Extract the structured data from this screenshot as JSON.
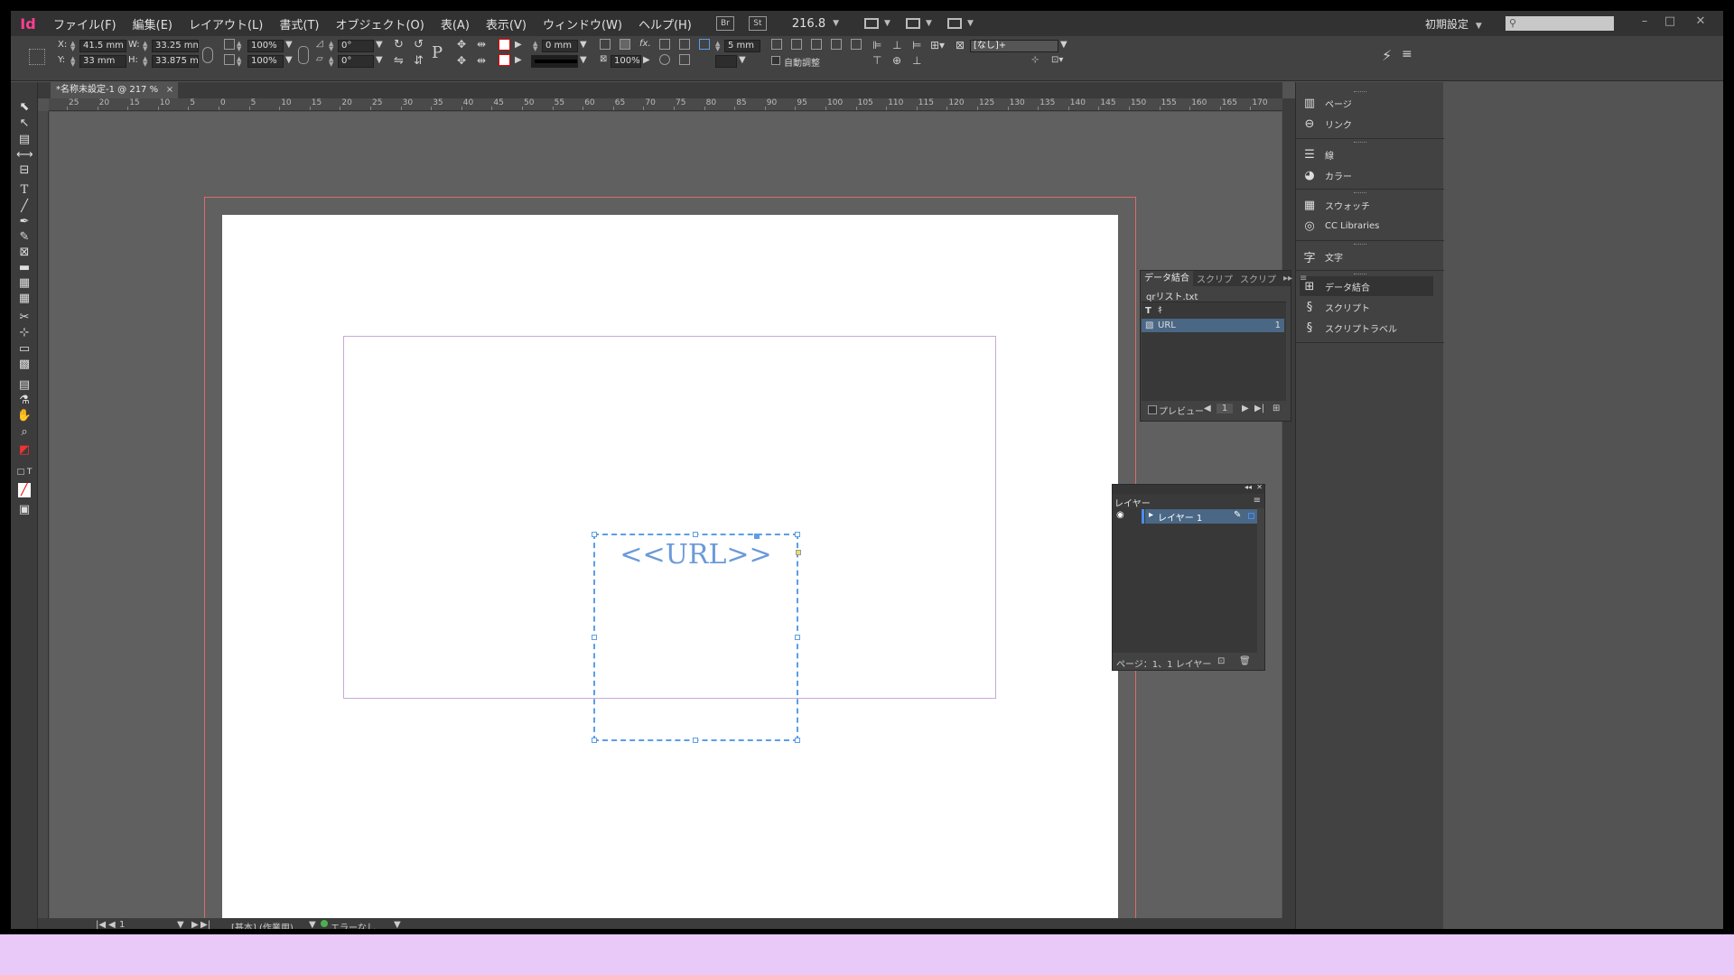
{
  "app": {
    "logo": "Id"
  },
  "menubar": {
    "items": [
      "ファイル(F)",
      "編集(E)",
      "レイアウト(L)",
      "書式(T)",
      "オブジェクト(O)",
      "表(A)",
      "表示(V)",
      "ウィンドウ(W)",
      "ヘルプ(H)"
    ],
    "bridge_label": "Br",
    "stock_label": "St",
    "zoom": "216.8",
    "workspace": "初期設定",
    "search_placeholder": "",
    "minimize": "–",
    "restore": "□",
    "close": "✕"
  },
  "control": {
    "x_label": "X:",
    "x_value": "41.5 mm",
    "y_label": "Y:",
    "y_value": "33 mm",
    "w_label": "W:",
    "w_value": "33.25 mm",
    "h_label": "H:",
    "h_value": "33.875 mm",
    "scale_x": "100%",
    "scale_y": "100%",
    "angle": "0°",
    "shear": "0°",
    "stroke_weight": "0 mm",
    "opacity": "100%",
    "corner_size": "5 mm",
    "auto_fit_label": "自動調整",
    "object_style": "[なし]+"
  },
  "document": {
    "tab_title": "*名称未設定-1 @ 217 %",
    "tab_close": "×",
    "frame_text": "<<URL>>"
  },
  "ruler": {
    "marks": [
      "25",
      "20",
      "15",
      "10",
      "5",
      "0",
      "5",
      "10",
      "15",
      "20",
      "25",
      "30",
      "35",
      "40",
      "45",
      "50",
      "55",
      "60",
      "65",
      "70",
      "75",
      "80",
      "85",
      "90",
      "95",
      "100",
      "105",
      "110",
      "115",
      "120",
      "125",
      "130",
      "135",
      "140",
      "145",
      "150",
      "155",
      "160",
      "165",
      "170"
    ]
  },
  "status": {
    "page": "1",
    "preflight_profile": "[基本] (作業用)",
    "errors": "エラーなし"
  },
  "dock": {
    "items": [
      {
        "label": "ページ",
        "icon": "pages-icon"
      },
      {
        "label": "リンク",
        "icon": "links-icon"
      },
      {
        "label": "線",
        "icon": "stroke-icon"
      },
      {
        "label": "カラー",
        "icon": "color-icon"
      },
      {
        "label": "スウォッチ",
        "icon": "swatches-icon"
      },
      {
        "label": "CC Libraries",
        "icon": "cc-libraries-icon"
      },
      {
        "label": "文字",
        "icon": "character-icon"
      },
      {
        "label": "データ結合",
        "icon": "data-merge-icon"
      },
      {
        "label": "スクリプト",
        "icon": "script-icon"
      },
      {
        "label": "スクリプトラベル",
        "icon": "script-label-icon"
      }
    ]
  },
  "data_merge": {
    "tabs": [
      "データ結合",
      "スクリプ",
      "スクリプ"
    ],
    "source_file": "qrリスト.txt",
    "fields": [
      {
        "type": "T",
        "name": "ｷ",
        "count": ""
      },
      {
        "type": "img",
        "name": "URL",
        "count": "1"
      }
    ],
    "preview_label": "プレビュー",
    "record": "1"
  },
  "layers": {
    "tab": "レイヤー",
    "layer_name": "レイヤー 1",
    "footer": "ページ：1、1 レイヤー"
  },
  "colors": {
    "app_bg": "#535353",
    "canvas_bg": "#606060",
    "bleed_guide": "#e06a6a",
    "margin_guide": "#c9a8d8",
    "frame_selection": "#5b9ee6",
    "frame_text": "#6a9ad8",
    "logo": "#ff3f94",
    "bottom_band": "#e9c9f7"
  }
}
